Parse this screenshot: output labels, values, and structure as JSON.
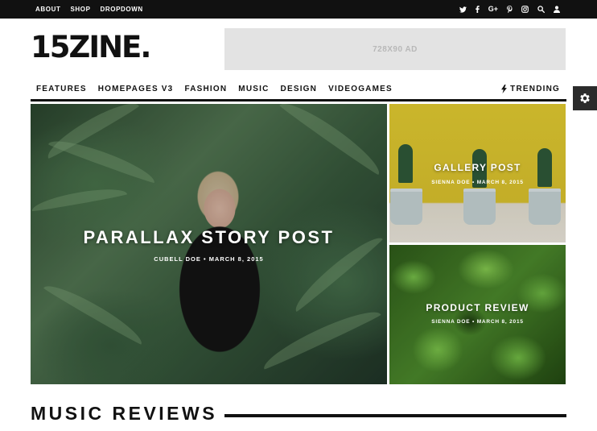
{
  "topbar": {
    "links": [
      "ABOUT",
      "SHOP",
      "DROPDOWN"
    ],
    "icons": [
      "twitter-icon",
      "facebook-icon",
      "google-plus-icon",
      "pinterest-icon",
      "instagram-icon",
      "search-icon",
      "user-icon"
    ]
  },
  "header": {
    "logo": "15ZINE.",
    "ad_label": "728X90 AD"
  },
  "nav": {
    "items": [
      "FEATURES",
      "HOMEPAGES V3",
      "FASHION",
      "MUSIC",
      "DESIGN",
      "VIDEOGAMES"
    ],
    "trending_label": "TRENDING"
  },
  "hero": {
    "title": "PARALLAX STORY POST",
    "meta": "CUBELL DOE  •  MARCH 8, 2015"
  },
  "tiles": [
    {
      "title": "GALLERY POST",
      "meta": "SIENNA DOE  •  MARCH 8, 2015"
    },
    {
      "title": "PRODUCT REVIEW",
      "meta": "SIENNA DOE  •  MARCH 8, 2015"
    }
  ],
  "section": {
    "title": "MUSIC REVIEWS"
  },
  "colors": {
    "topbar": "#111111",
    "ad_background": "#e3e3e3",
    "settings_button": "#2b2b2b"
  }
}
